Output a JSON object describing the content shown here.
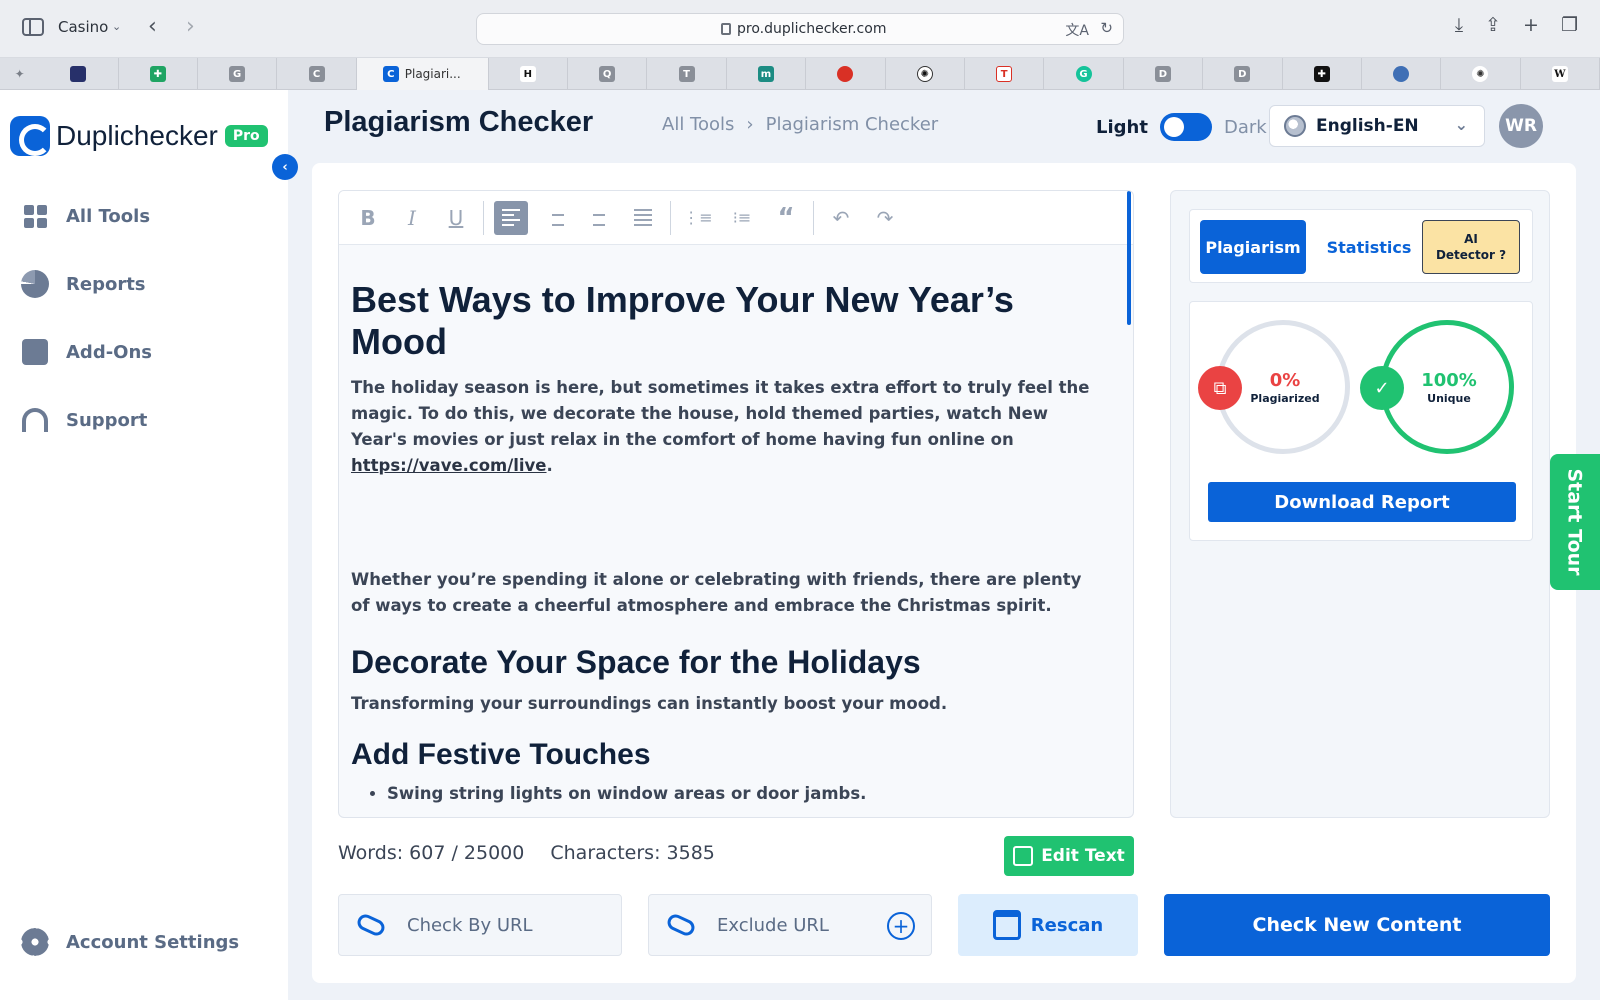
{
  "browser": {
    "profile": "Casino",
    "url": "pro.duplichecker.com",
    "active_tab_title": "Plagiari...",
    "tab_favicons": [
      "",
      "G",
      "C",
      "",
      "H",
      "Q",
      "T",
      "m",
      "",
      "",
      "T",
      "G",
      "D",
      "D",
      "",
      "",
      "",
      "W"
    ]
  },
  "brand": {
    "name": "Duplichecker",
    "badge": "Pro"
  },
  "sidebar": {
    "items": [
      {
        "label": "All Tools",
        "icon": "grid-icon"
      },
      {
        "label": "Reports",
        "icon": "pie-chart-icon"
      },
      {
        "label": "Add-Ons",
        "icon": "puzzle-icon"
      },
      {
        "label": "Support",
        "icon": "headset-icon"
      }
    ],
    "account": "Account Settings"
  },
  "header": {
    "title": "Plagiarism Checker",
    "breadcrumb": [
      "All Tools",
      "Plagiarism Checker"
    ],
    "theme_light": "Light",
    "theme_dark": "Dark",
    "language": "English-EN",
    "avatar_initials": "WR"
  },
  "editor": {
    "heading1": "Best Ways to Improve Your New Year’s Mood",
    "para1": "The holiday season is here, but sometimes it takes extra effort to truly feel the magic. To do this, we decorate the house, hold themed parties, watch New Year's movies or just relax in the comfort of home having fun online on",
    "link": "https://vave.com/live",
    "para2": "Whether you’re spending it alone or celebrating with friends, there are plenty of ways to create a cheerful atmosphere and embrace the Christmas spirit.",
    "heading2": "Decorate Your Space for the Holidays",
    "para3": "Transforming your surroundings can instantly boost your mood.",
    "heading3": "Add Festive Touches",
    "bullet1": "Swing string lights on window areas or door jambs."
  },
  "stats": {
    "words": "Words: 607 / 25000",
    "characters": "Characters: 3585"
  },
  "actions": {
    "edit_text": "Edit Text",
    "check_by_url": "Check By URL",
    "exclude_url": "Exclude URL",
    "rescan": "Rescan",
    "check_new": "Check New Content"
  },
  "results": {
    "tab_plagiarism": "Plagiarism",
    "tab_statistics": "Statistics",
    "tab_ai_line1": "AI",
    "tab_ai_line2": "Detector ?",
    "plagiarized_value": "0%",
    "plagiarized_label": "Plagiarized",
    "unique_value": "100%",
    "unique_label": "Unique",
    "plagiarized_fraction": 0,
    "unique_fraction": 1,
    "download": "Download Report"
  },
  "tour": {
    "label": "Start Tour"
  },
  "colors": {
    "primary": "#0a63d8",
    "success": "#20c271",
    "danger": "#ea4343",
    "ai_badge": "#fbe3a4"
  }
}
